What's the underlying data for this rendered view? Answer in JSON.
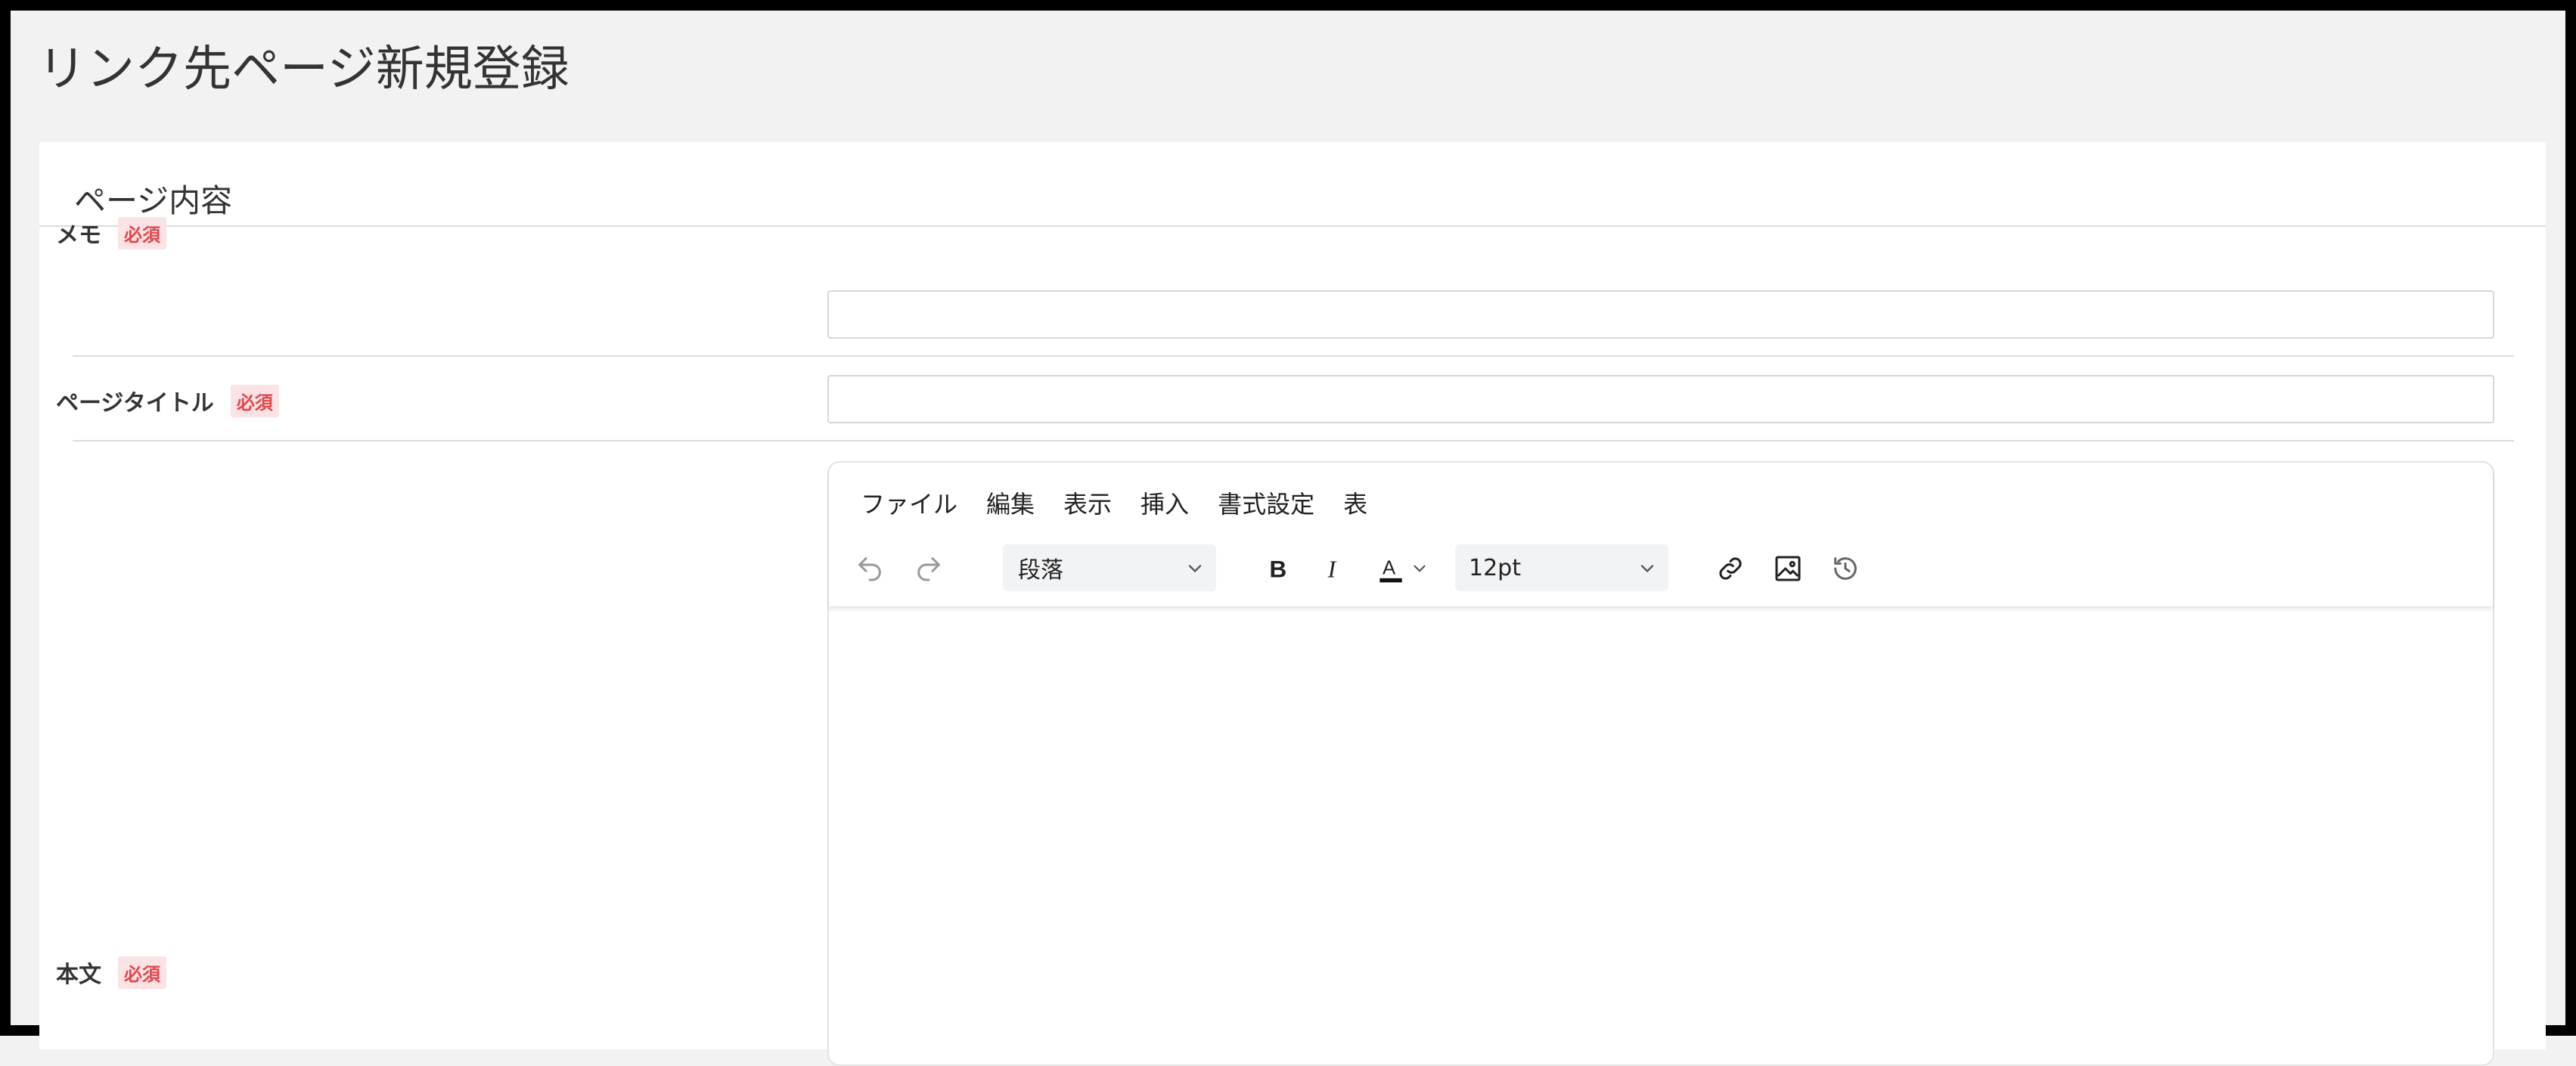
{
  "page": {
    "title": "リンク先ページ新規登録"
  },
  "panel": {
    "title": "ページ内容"
  },
  "form": {
    "required_badge": "必須",
    "memo": {
      "label": "メモ",
      "value": ""
    },
    "page_title": {
      "label": "ページタイトル",
      "value": ""
    },
    "body": {
      "label": "本文"
    }
  },
  "editor": {
    "menu": [
      "ファイル",
      "編集",
      "表示",
      "挿入",
      "書式設定",
      "表"
    ],
    "block_format": "段落",
    "font_size": "12pt",
    "icons": [
      "undo-icon",
      "redo-icon",
      "bold-icon",
      "italic-icon",
      "text-color-icon",
      "link-icon",
      "image-icon",
      "history-icon"
    ]
  },
  "colors": {
    "badge_bg": "#fbe3e3",
    "badge_text": "#e0474c",
    "background": "#f2f2f2"
  }
}
